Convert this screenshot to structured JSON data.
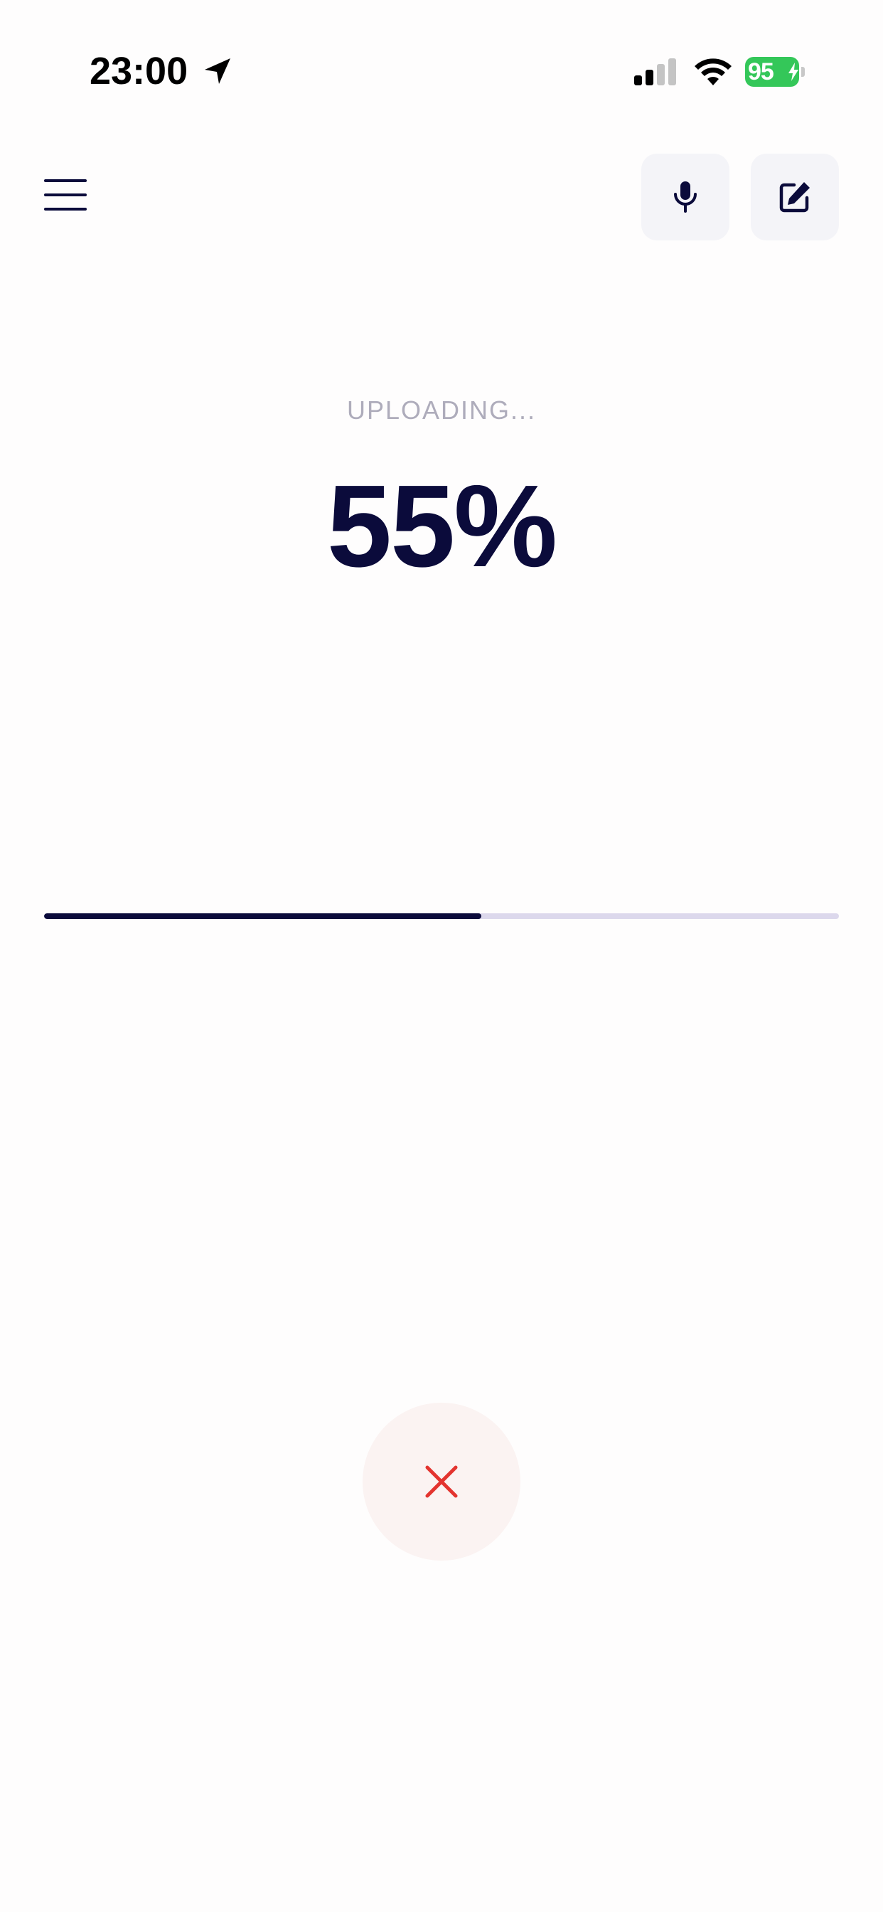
{
  "status_bar": {
    "time": "23:00",
    "battery_level": "95",
    "icons": [
      "location-arrow-icon",
      "cellular-signal-icon",
      "wifi-icon",
      "battery-icon"
    ]
  },
  "header": {
    "icons": [
      "hamburger-menu-icon",
      "microphone-icon",
      "edit-icon"
    ]
  },
  "upload": {
    "label": "UPLOADING...",
    "percent_text": "55%",
    "progress": 0.55
  },
  "cancel": {
    "icon": "close-icon"
  },
  "colors": {
    "primary": "#0b0b3b",
    "track": "#dcd8ec",
    "label": "#aeacbb",
    "cancel_icon": "#e3342f",
    "cancel_bg": "#fbf3f2",
    "button_bg": "#f4f4f8",
    "battery": "#34c759"
  }
}
